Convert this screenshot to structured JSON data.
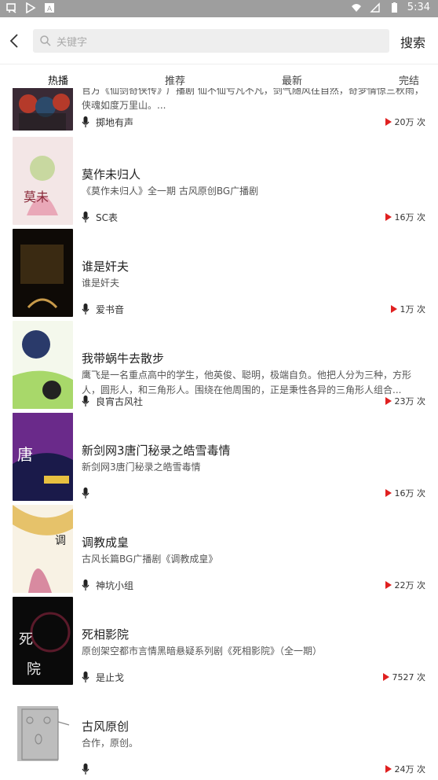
{
  "status": {
    "time": "5:34"
  },
  "header": {
    "search_placeholder": "关键字",
    "search_button": "搜索"
  },
  "tabs": [
    {
      "label": "热播",
      "active": true
    },
    {
      "label": "推荐",
      "active": false
    },
    {
      "label": "最新",
      "active": false
    },
    {
      "label": "完结",
      "active": false
    }
  ],
  "items": [
    {
      "title": "",
      "desc": "官方《仙剑奇侠传》广播剧 仙不仙亏凡不凡，剑气随风往自然，奇梦情惊三秋雨，侠魂如度万里山。...",
      "author": "掷地有声",
      "plays": "20万 次",
      "cover_colors": [
        "#3a2a35",
        "#b53a2a",
        "#2c4a6a"
      ]
    },
    {
      "title": "莫作未归人",
      "desc": "《莫作未归人》全一期 古风原创BG广播剧",
      "author": "SC表",
      "plays": "16万 次",
      "cover_colors": [
        "#f3e6e6",
        "#e9a8b8",
        "#c8d8a0"
      ]
    },
    {
      "title": "谁是奸夫",
      "desc": "谁是奸夫",
      "author": "爱书音",
      "plays": "1万 次",
      "cover_colors": [
        "#0e0a06",
        "#3a2a12",
        "#c89a4a"
      ]
    },
    {
      "title": "我带蜗牛去散步",
      "desc": "鹰飞是一名重点高中的学生，他英俊、聪明，极端自负。他把人分为三种，方形人，圆形人，和三角形人。围绕在他周围的，正是秉性各异的三角形人组合...",
      "author": "良宵古风社",
      "plays": "23万 次",
      "cover_colors": [
        "#f4f8ec",
        "#a8d86a",
        "#2a3a6a"
      ]
    },
    {
      "title": "新剑网3唐门秘录之皓雪毒情",
      "desc": "新剑网3唐门秘录之皓雪毒情",
      "author": "",
      "plays": "16万 次",
      "cover_colors": [
        "#1a1a4a",
        "#6a2a8a",
        "#e8c040"
      ]
    },
    {
      "title": "调教成皇",
      "desc": "古风长篇BG广播剧《调教成皇》",
      "author": "神坑小组",
      "plays": "22万 次",
      "cover_colors": [
        "#f8f2e4",
        "#e6c26a",
        "#d88aa0"
      ]
    },
    {
      "title": "死相影院",
      "desc": "原创架空都市言情黑暗悬疑系列剧《死相影院》（全一期）",
      "author": "是止戈",
      "plays": "7527 次",
      "cover_colors": [
        "#0a0a0a",
        "#5a1a2a",
        "#e8e8e8"
      ]
    },
    {
      "title": "古风原创",
      "desc": "合作，原创。",
      "author": "",
      "plays": "24万 次",
      "cover_colors": [
        "#ffffff",
        "#bdbdbd",
        "#8a8a8a"
      ]
    }
  ]
}
